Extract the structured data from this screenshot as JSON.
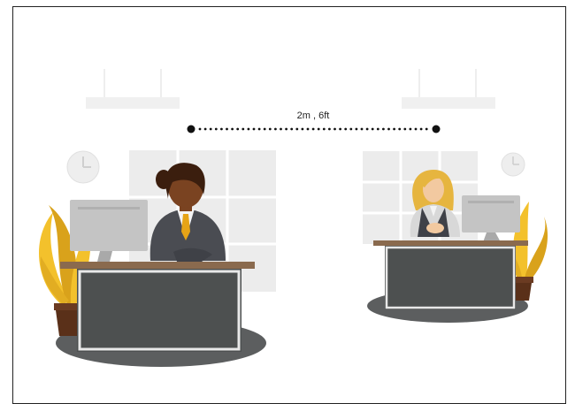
{
  "distance_label": "2m , 6ft",
  "colors": {
    "frame": "#222222",
    "lamp": "#f0f0f0",
    "window": "#ececec",
    "window_line": "#ffffff",
    "clock_face": "#eeeeee",
    "clock_hand": "#cfcfcf",
    "floor_shadow": "#5c5e5f",
    "desk_top": "#8a6a4e",
    "desk_panel": "#4d5050",
    "desk_frame": "#e8e8e8",
    "monitor": "#c4c4c4",
    "monitor_stand": "#a9a9a9",
    "plant_leaf": "#f3c12c",
    "plant_leaf_dark": "#d9a21b",
    "pot": "#6b3b22",
    "man_skin": "#7a4321",
    "man_hair": "#3b1e0e",
    "suit": "#4a4c52",
    "shirt": "#f4f4f4",
    "tie": "#e6a417",
    "woman_hair": "#e6b53f",
    "woman_skin": "#f2c9a0",
    "woman_vest": "#3f4148",
    "dots": "#111111"
  },
  "icons": {
    "left_clock": "clock-icon",
    "right_clock": "clock-icon"
  }
}
